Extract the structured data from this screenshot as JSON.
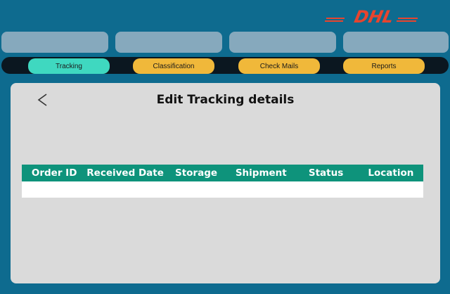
{
  "brand": {
    "logo_text": "DHL",
    "color": "#e8442e"
  },
  "top_bar": {
    "tab_count": 4
  },
  "nav": {
    "items": [
      {
        "label": "Tracking",
        "active": true
      },
      {
        "label": "Classification",
        "active": false
      },
      {
        "label": "Check Mails",
        "active": false
      },
      {
        "label": "Reports",
        "active": false
      }
    ]
  },
  "panel": {
    "back_icon": "chevron-left-icon",
    "title": "Edit Tracking details"
  },
  "table": {
    "columns": [
      "Order ID",
      "Received Date",
      "Storage",
      "Shipment",
      "Status",
      "Location"
    ],
    "rows": [
      [
        "",
        "",
        "",
        "",
        "",
        ""
      ]
    ]
  },
  "colors": {
    "page_bg": "#0e6b8f",
    "nav_active": "#3fd8c0",
    "nav_inactive": "#f0b83a",
    "table_header": "#0e937b",
    "panel_bg": "#dadada"
  }
}
